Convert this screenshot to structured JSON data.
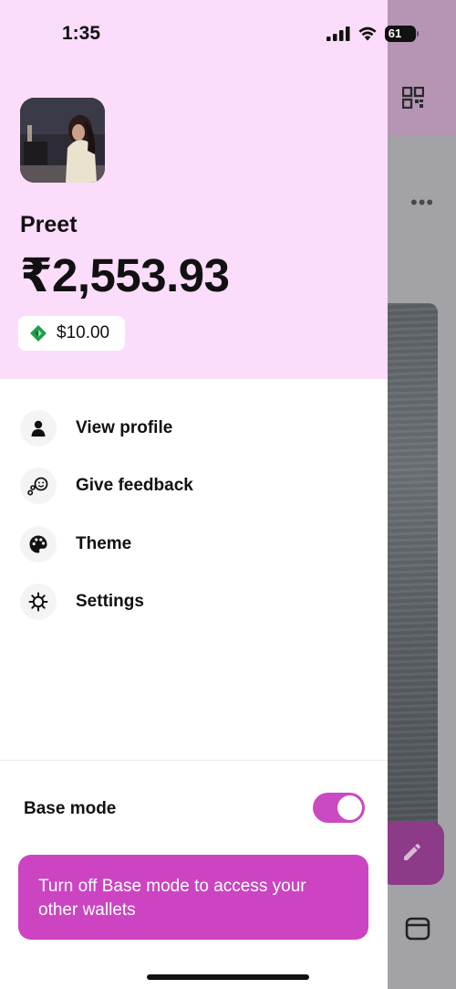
{
  "status_bar": {
    "time": "1:35",
    "battery": "61"
  },
  "drawer": {
    "profile_name": "Preet",
    "balance": "₹2,553.93",
    "token_balance": "$10.00",
    "menu": [
      {
        "label": "View profile",
        "icon": "person-icon"
      },
      {
        "label": "Give feedback",
        "icon": "feedback-icon"
      },
      {
        "label": "Theme",
        "icon": "palette-icon"
      },
      {
        "label": "Settings",
        "icon": "gear-icon"
      }
    ],
    "base_mode": {
      "label": "Base mode",
      "enabled": true
    },
    "banner_text": "Turn off Base mode to access your other wallets"
  },
  "colors": {
    "header_bg": "#fcdcfb",
    "accent": "#cc44c2",
    "token_green": "#1e9e4a"
  },
  "background_icons": [
    "qr-code-icon",
    "more-dots-icon",
    "edit-pencil-icon",
    "tabs-icon"
  ]
}
